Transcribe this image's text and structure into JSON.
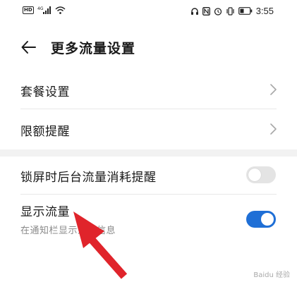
{
  "status_bar": {
    "network_badge": "HD",
    "network_type": "4G",
    "time": "3:55",
    "icons": [
      "headset-icon",
      "nfc-icon",
      "alarm-icon",
      "vibrate-icon",
      "battery-icon"
    ]
  },
  "header": {
    "title": "更多流量设置",
    "back_icon": "back-arrow-icon"
  },
  "rows": [
    {
      "label": "套餐设置",
      "control": "chevron"
    },
    {
      "label": "限额提醒",
      "control": "chevron"
    },
    {
      "label": "锁屏时后台流量消耗提醒",
      "control": "toggle",
      "state": "off"
    },
    {
      "label": "显示流量",
      "sublabel": "在通知栏显示流量信息",
      "control": "toggle",
      "state": "on"
    }
  ],
  "colors": {
    "toggle_on": "#1f6fd6",
    "toggle_off": "#e4e4e4",
    "annotation_arrow": "#e0242b"
  },
  "watermark": "Baidu 经验"
}
